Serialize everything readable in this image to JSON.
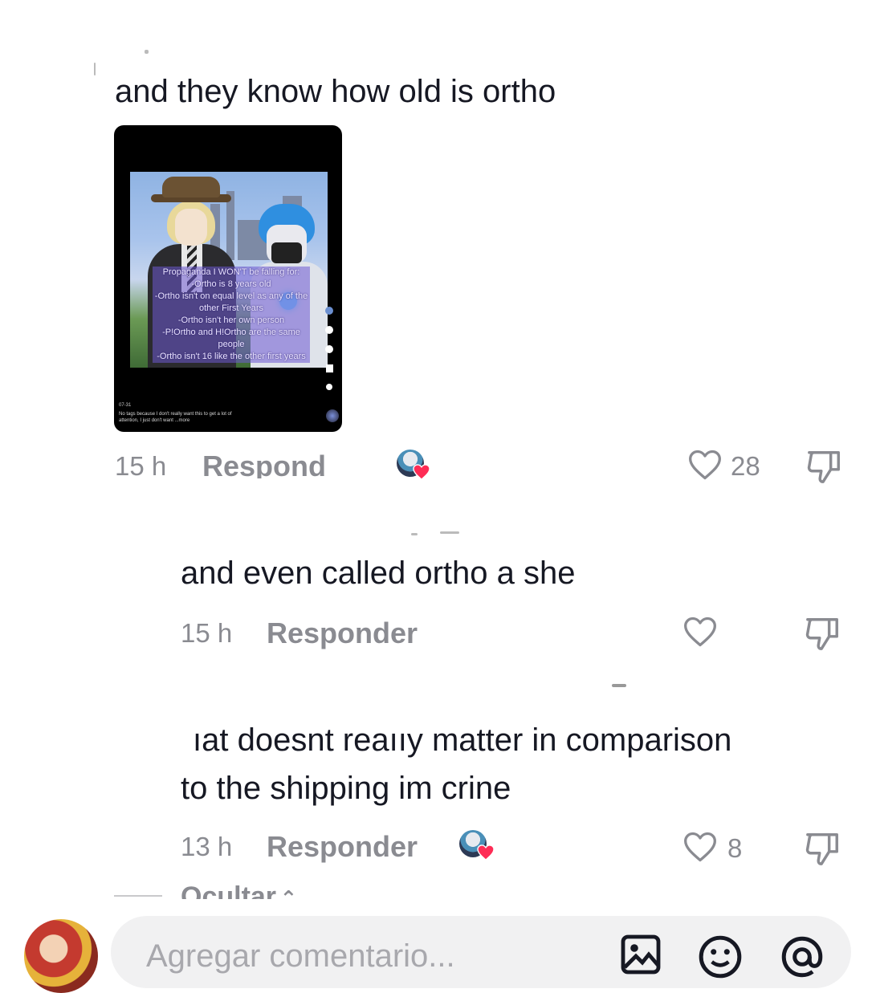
{
  "comments": [
    {
      "text": "and they know how old is ortho",
      "video": {
        "overlay": "Propaganda I WON'T be falling for:\n-Ortho is 8 years old\n-Ortho isn't on equal level as any of the other First Years\n-Ortho isn't her own person\n-P!Ortho and H!Ortho are the same people\n-Ortho isn't 16 like the other first years",
        "user_date": "07-31",
        "caption": "No tags because I don't really want this to get a lot of attention, I just don't want ...more"
      },
      "time": "15 h",
      "reply": "Respond",
      "likes": "28"
    },
    {
      "text": "and even called ortho a she",
      "time": "15 h",
      "reply": "Responder"
    },
    {
      "text": "ıat doesnt reaııy matter in comparison to the shipping im crine",
      "text_line1": "ıat doesnt reaııy matter in comparison",
      "text_line2": "to the shipping im crine",
      "time": "13 h",
      "reply": "Responder",
      "likes": "8"
    }
  ],
  "hide_label": "Ocultar",
  "composer": {
    "placeholder": "Agregar comentario..."
  },
  "icons": {
    "like": "heart-outline-icon",
    "dislike": "thumbs-down-icon",
    "image": "image-icon",
    "emoji": "emoji-icon",
    "mention": "at-mention-icon"
  },
  "colors": {
    "text": "#161823",
    "muted": "#8a8b91",
    "heart": "#fe2c55",
    "composer_bg": "#f1f1f2"
  }
}
